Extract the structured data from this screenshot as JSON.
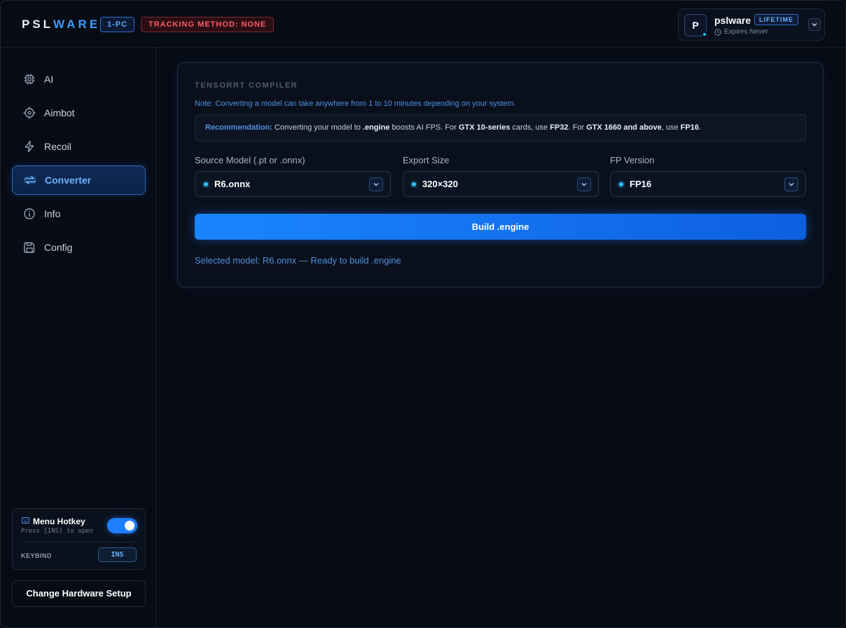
{
  "header": {
    "brand_part1": "PSL",
    "brand_part2": "WARE",
    "pc_badge": "1-PC",
    "tracking_badge": "TRACKING METHOD: NONE",
    "user": {
      "avatar_letter": "P",
      "name": "pslware",
      "plan": "LIFETIME",
      "expires": "Expires Never"
    }
  },
  "sidebar": {
    "items": [
      {
        "label": "AI",
        "icon": "cpu-icon",
        "active": false
      },
      {
        "label": "Aimbot",
        "icon": "crosshair-icon",
        "active": false
      },
      {
        "label": "Recoil",
        "icon": "lightning-icon",
        "active": false
      },
      {
        "label": "Converter",
        "icon": "convert-arrows-icon",
        "active": true
      },
      {
        "label": "Info",
        "icon": "info-icon",
        "active": false
      },
      {
        "label": "Config",
        "icon": "save-disk-icon",
        "active": false
      }
    ],
    "hotkey": {
      "title": "Menu Hotkey",
      "subtitle": "Press [INS] to open",
      "enabled": true,
      "keybind_label": "KEYBIND",
      "keybind_value": "INS"
    },
    "hardware_button": "Change Hardware Setup"
  },
  "panel": {
    "title": "TENSORRT COMPILER",
    "note": "Note: Converting a model can take anywhere from 1 to 10 minutes depending on your system.",
    "recommendation": {
      "label": "Recommendation:",
      "t1": " Converting your model to ",
      "b1": ".engine",
      "t2": " boosts AI FPS. For ",
      "b2": "GTX 10-series",
      "t3": " cards, use ",
      "b3": "FP32",
      "t4": ". For ",
      "b4": "GTX 1660 and above",
      "t5": ", use ",
      "b5": "FP16",
      "t6": "."
    },
    "fields": [
      {
        "label": "Source Model (.pt or .onnx)",
        "value": "R6.onnx"
      },
      {
        "label": "Export Size",
        "value": "320×320"
      },
      {
        "label": "FP Version",
        "value": "FP16"
      }
    ],
    "build_button": "Build .engine",
    "status": "Selected model: R6.onnx — Ready to build .engine"
  },
  "colors": {
    "accent": "#1f7dff",
    "accent_text": "#4f8fe0",
    "danger": "#ff5a66",
    "background": "#070b14"
  }
}
